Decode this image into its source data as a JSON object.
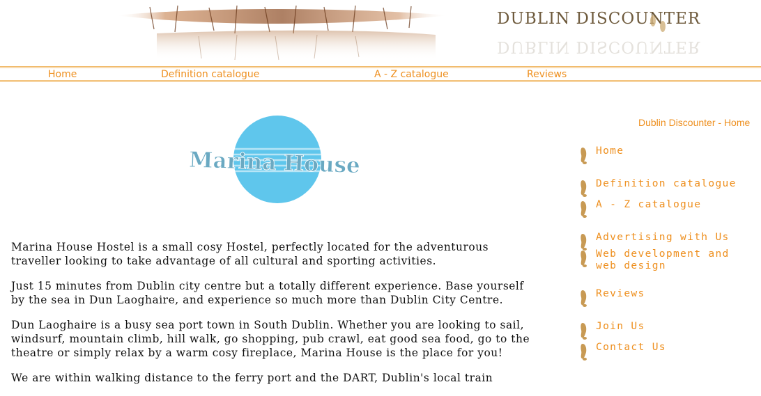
{
  "header": {
    "logo_text": "DUBLIN DISCOUNTER"
  },
  "topnav": {
    "items": [
      "Home",
      "Definition catalogue",
      "A - Z catalogue",
      "Reviews"
    ]
  },
  "hero": {
    "logo_text": "Marina House",
    "colors": {
      "circle": "#5fc6ec",
      "text": "#6aa9c2"
    }
  },
  "content": {
    "paragraphs": [
      "Marina House Hostel is a small cosy Hostel, perfectly located for the adventurous traveller looking to take advantage of all cultural and sporting activities.",
      "Just 15 minutes from Dublin city centre but a totally different experience. Base yourself by the sea in Dun Laoghaire, and experience so much more than Dublin City Centre.",
      "Dun Laoghaire is a busy sea port town in South Dublin. Whether you are looking to sail, windsurf, mountain climb, hill walk, go shopping, pub crawl, eat good sea food, go to the theatre or simply relax by a warm cosy fireplace, Marina House is the place for you!",
      "We are within walking distance to the ferry port and the DART, Dublin's local train"
    ]
  },
  "sidebar": {
    "title": "Dublin Discounter - Home",
    "items": [
      {
        "label": "Home",
        "icon": "footprint-icon"
      },
      {
        "label": "Definition catalogue",
        "icon": "footprint-icon"
      },
      {
        "label": "A - Z catalogue",
        "icon": "footprint-icon"
      },
      {
        "label": "Advertising with Us",
        "icon": "footprint-icon"
      },
      {
        "label": "Web development and web design",
        "icon": "footprint-icon"
      },
      {
        "label": "Reviews",
        "icon": "footprint-icon"
      },
      {
        "label": "Join Us",
        "icon": "footprint-icon"
      },
      {
        "label": "Contact Us",
        "icon": "footprint-icon"
      }
    ]
  },
  "colors": {
    "accent": "#ee8f1e",
    "rule": "#f0b866",
    "text": "#111111"
  }
}
